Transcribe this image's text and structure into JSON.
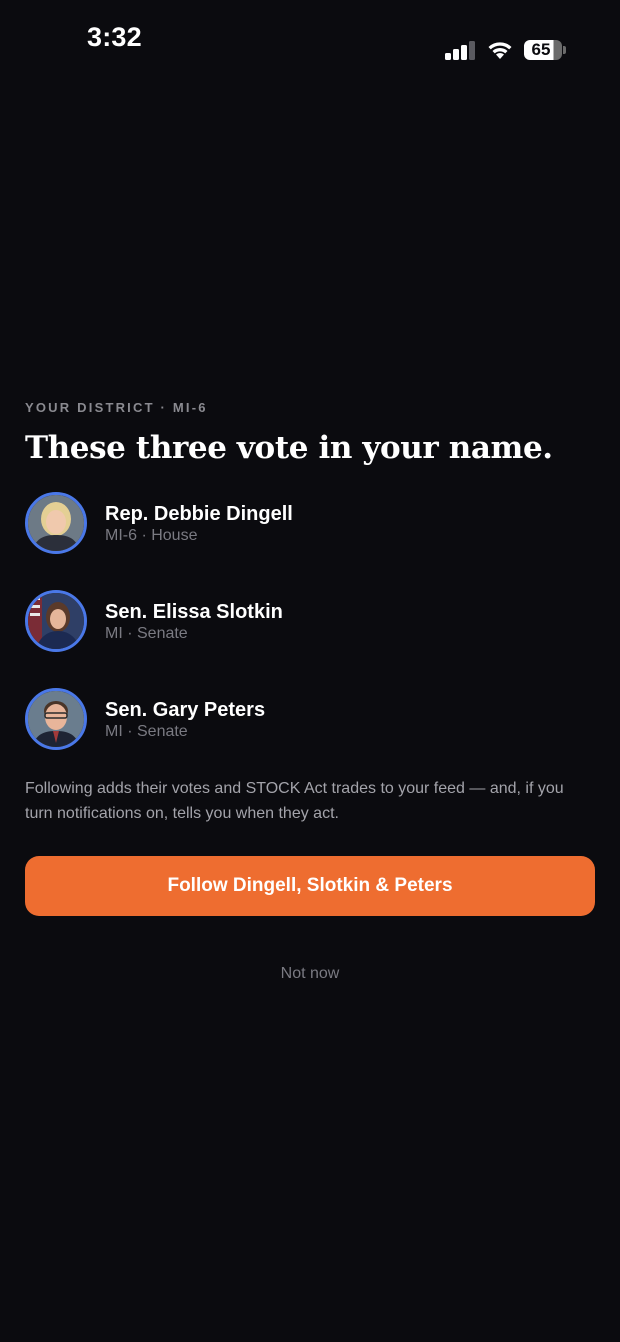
{
  "status_bar": {
    "time": "3:32",
    "battery_level": "65",
    "icons": [
      "cellular-signal-icon",
      "wifi-icon",
      "battery-icon"
    ]
  },
  "district": {
    "eyebrow": "YOUR DISTRICT · MI-6",
    "headline": "These three vote in your name."
  },
  "representatives": [
    {
      "name": "Rep. Debbie Dingell",
      "meta": "MI-6 · House",
      "avatar_icon": "portrait-photo-icon"
    },
    {
      "name": "Sen. Elissa Slotkin",
      "meta": "MI · Senate",
      "avatar_icon": "portrait-photo-icon"
    },
    {
      "name": "Sen. Gary Peters",
      "meta": "MI · Senate",
      "avatar_icon": "portrait-photo-icon"
    }
  ],
  "description": "Following adds their votes and STOCK Act trades to your feed — and, if you turn notifications on, tells you when they act.",
  "actions": {
    "follow_label": "Follow Dingell, Slotkin & Peters",
    "dismiss_label": "Not now"
  },
  "colors": {
    "background": "#0b0b0f",
    "accent": "#ee6d30",
    "avatar_ring": "#4a78e8",
    "muted_text": "#7a7a82"
  }
}
